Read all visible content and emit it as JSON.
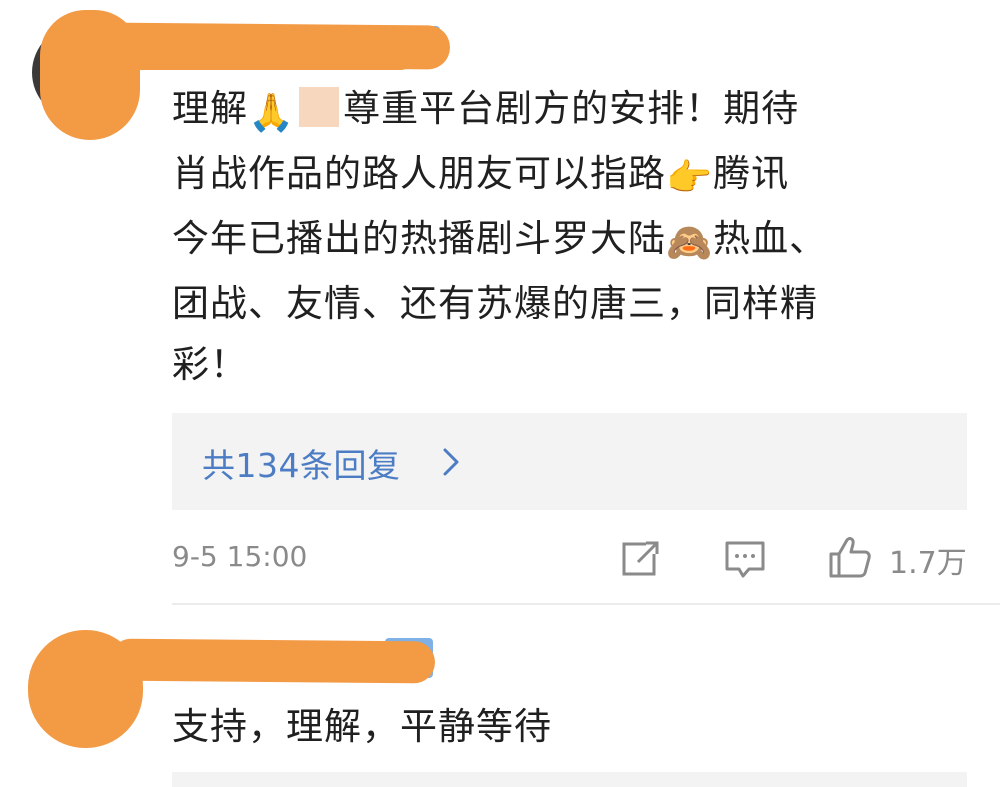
{
  "comment1": {
    "text_line1_a": "理解",
    "emoji_pray": "🙏",
    "text_line1_b": "尊重平台剧方的安排！期待",
    "text_line2_a": "肖战作品的路人朋友可以指路",
    "emoji_point": "👉",
    "text_line2_b": "腾讯",
    "text_line3_a": "今年已播出的热播剧斗罗大陆",
    "emoji_monkey": "🙈",
    "text_line3_b": "热血、",
    "text_line4": "团战、友情、还有苏爆的唐三，同样精",
    "text_line5": "彩！",
    "reply_label": "共134条回复",
    "timestamp": "9-5 15:00",
    "like_count": "1.7万"
  },
  "comment2": {
    "text": "支持，理解，平静等待"
  },
  "colors": {
    "link": "#4b7cc4",
    "redaction": "#f39a45",
    "meta": "#8a8a8a",
    "reply_bg": "#f3f3f3"
  },
  "icons": [
    "share-icon",
    "comment-icon",
    "like-thumb-icon",
    "chevron-right-icon"
  ]
}
